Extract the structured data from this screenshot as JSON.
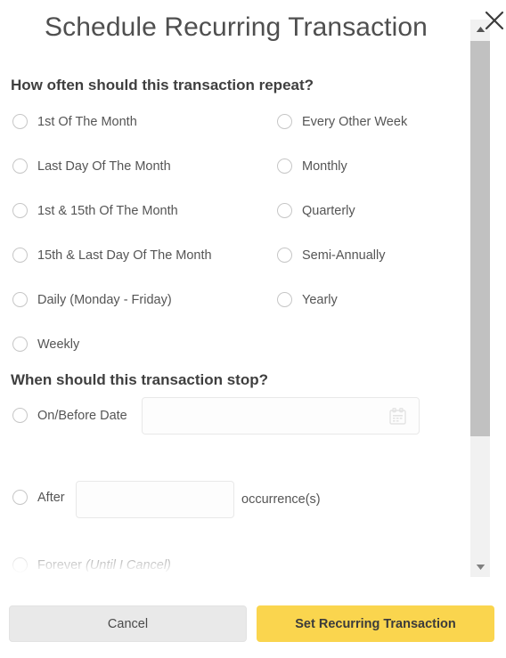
{
  "dialog": {
    "title": "Schedule Recurring Transaction",
    "close_icon": "close-icon"
  },
  "repeat_section": {
    "heading": "How often should this transaction repeat?",
    "left_options": [
      {
        "label": "1st Of The Month",
        "selected": false
      },
      {
        "label": "Last Day Of The Month",
        "selected": false
      },
      {
        "label": "1st & 15th Of The Month",
        "selected": false
      },
      {
        "label": "15th & Last Day Of The Month",
        "selected": false
      },
      {
        "label": "Daily (Monday - Friday)",
        "selected": false
      },
      {
        "label": "Weekly",
        "selected": false
      }
    ],
    "right_options": [
      {
        "label": "Every Other Week",
        "selected": false
      },
      {
        "label": "Monthly",
        "selected": false
      },
      {
        "label": "Quarterly",
        "selected": false
      },
      {
        "label": "Semi-Annually",
        "selected": false
      },
      {
        "label": "Yearly",
        "selected": false
      }
    ]
  },
  "stop_section": {
    "heading": "When should this transaction stop?",
    "on_before_date": {
      "label": "On/Before Date",
      "input_value": "",
      "input_placeholder": "",
      "calendar_icon": "calendar-icon"
    },
    "after": {
      "label": "After",
      "input_value": "",
      "input_placeholder": "",
      "suffix": "occurrence(s)"
    },
    "forever": {
      "label": "Forever ",
      "label_italic": "(Until I Cancel)"
    }
  },
  "scrollbar": {
    "up_icon": "caret-up-icon",
    "down_icon": "caret-down-icon"
  },
  "footer": {
    "cancel_label": "Cancel",
    "submit_label": "Set Recurring Transaction"
  },
  "colors": {
    "accent": "#fad54e",
    "cancel_bg": "#e9e9e9",
    "text": "#555555",
    "heading": "#3f3f3f",
    "scrollbar_thumb": "#c1c1c1"
  }
}
